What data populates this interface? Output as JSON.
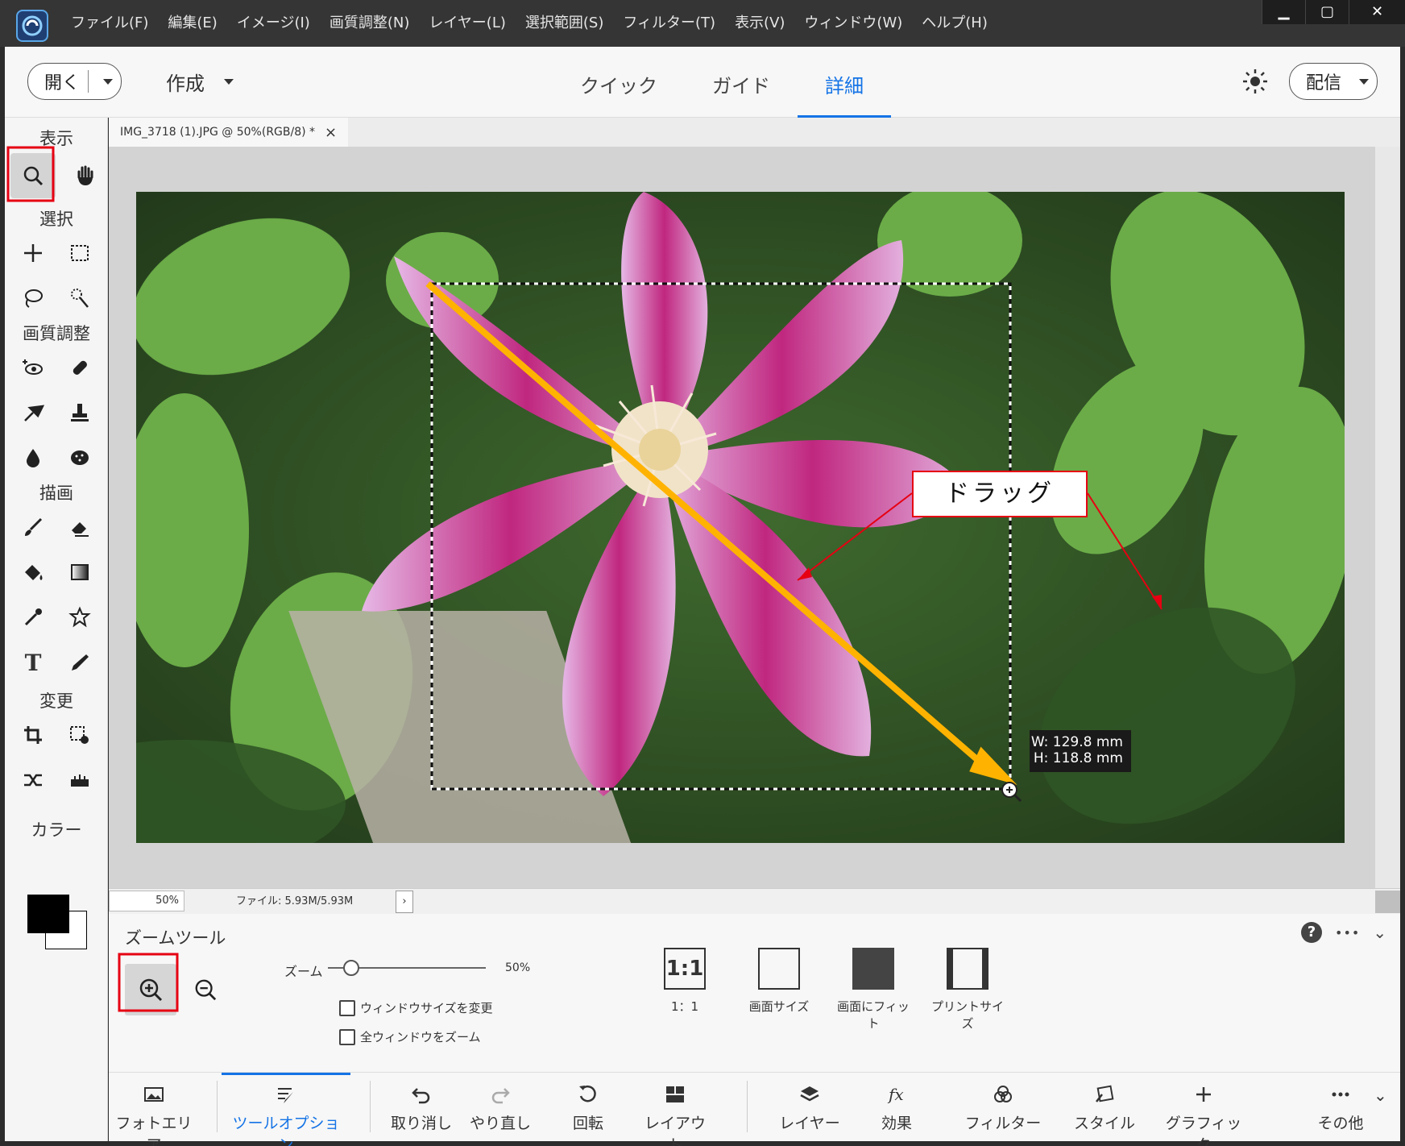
{
  "menu": [
    "ファイル(F)",
    "編集(E)",
    "イメージ(I)",
    "画質調整(N)",
    "レイヤー(L)",
    "選択範囲(S)",
    "フィルター(T)",
    "表示(V)",
    "ウィンドウ(W)",
    "ヘルプ(H)"
  ],
  "window_controls": {
    "minimize": "▁",
    "maximize": "▢",
    "close": "✕"
  },
  "topbar": {
    "open_label": "開く",
    "create_label": "作成",
    "share_label": "配信"
  },
  "modes": [
    {
      "label": "クイック",
      "active": false
    },
    {
      "label": "ガイド",
      "active": false
    },
    {
      "label": "詳細",
      "active": true
    }
  ],
  "toolbox": {
    "section_view": "表示",
    "section_select": "選択",
    "section_enhance": "画質調整",
    "section_draw": "描画",
    "section_modify": "変更",
    "section_color": "カラー",
    "type_tool": "T"
  },
  "document": {
    "tab_title": "IMG_3718 (1).JPG @ 50%(RGB/8) *",
    "close": "×"
  },
  "status": {
    "zoom": "50%",
    "file_info": "ファイル: 5.93M/5.93M",
    "arrow": "›"
  },
  "tool_options": {
    "title": "ズームツール",
    "zoom_label": "ズーム",
    "zoom_value": "50%",
    "zoom_level": 0.15,
    "checkbox_resize": "ウィンドウサイズを変更",
    "checkbox_zoom_all": "全ウィンドウをズーム",
    "btn_1to1_icon": "1:1",
    "btn_1to1": "1：1",
    "btn_screen": "画面サイズ",
    "btn_fit": "画面にフィット",
    "btn_print": "プリントサイズ",
    "help": "?",
    "more": "•••",
    "collapse": "⌄"
  },
  "taskbar": [
    {
      "label": "フォトエリア",
      "icon": "photo-bin-icon",
      "active": false
    },
    {
      "label": "ツールオプション",
      "icon": "tool-options-icon",
      "active": true
    },
    {
      "label": "取り消し",
      "icon": "undo-icon",
      "active": false
    },
    {
      "label": "やり直し",
      "icon": "redo-icon",
      "active": false
    },
    {
      "label": "回転",
      "icon": "rotate-icon",
      "active": false
    },
    {
      "label": "レイアウト",
      "icon": "layout-icon",
      "active": false
    },
    {
      "label": "レイヤー",
      "icon": "layers-icon",
      "active": false
    },
    {
      "label": "効果",
      "icon": "fx-icon",
      "active": false
    },
    {
      "label": "フィルター",
      "icon": "filter-icon",
      "active": false
    },
    {
      "label": "スタイル",
      "icon": "styles-icon",
      "active": false
    },
    {
      "label": "グラフィック",
      "icon": "graphics-icon",
      "active": false
    },
    {
      "label": "その他",
      "icon": "more-icon",
      "active": false
    }
  ],
  "annotation": {
    "callout": "ドラッグ",
    "tooltip_w": "W: 129.8 mm",
    "tooltip_h": "H: 118.8 mm"
  },
  "colors": {
    "accent": "#1473e6",
    "annotation_red": "#e60012",
    "drag_arrow": "#ffb300"
  }
}
